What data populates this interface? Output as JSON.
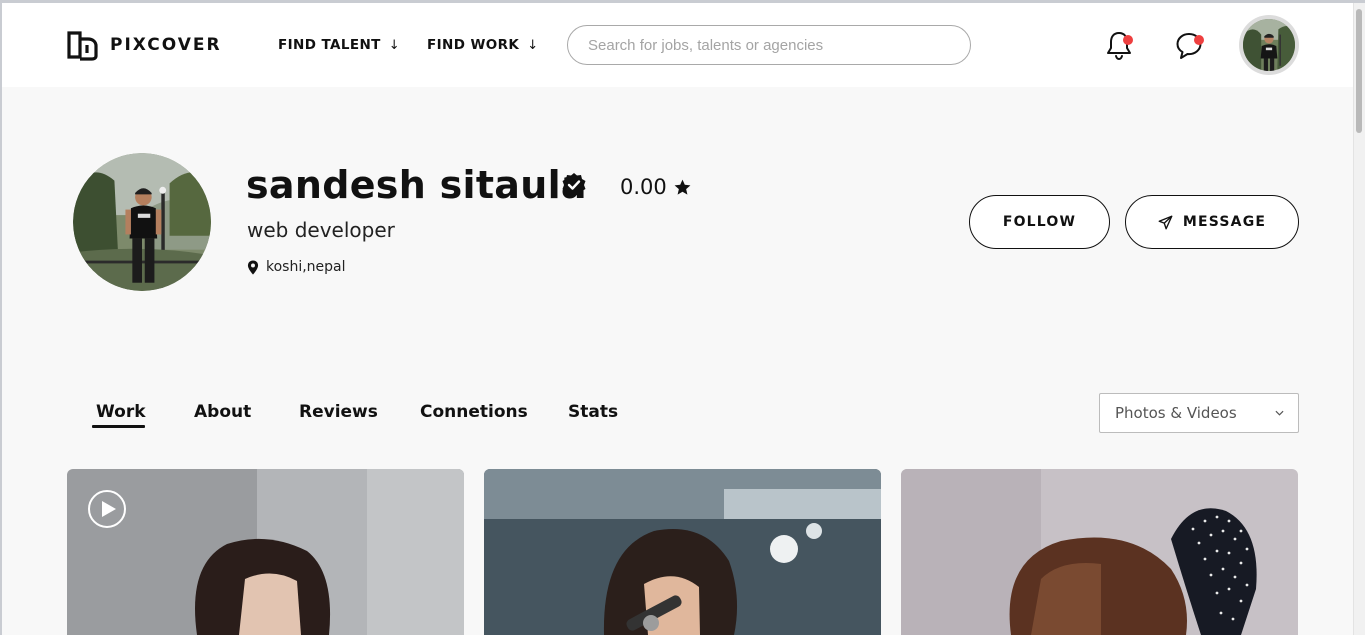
{
  "header": {
    "logo_text": "PIXCOVER",
    "nav": [
      {
        "label": "FIND TALENT",
        "arrow": "↓"
      },
      {
        "label": "FIND WORK",
        "arrow": "↓"
      }
    ],
    "search_placeholder": "Search for jobs, talents or agencies",
    "notification_badge_color": "#ee3f3f",
    "icons": [
      "bell-icon",
      "chat-bubble-icon"
    ]
  },
  "profile": {
    "name": "sandesh sitaula",
    "verified": true,
    "rating": "0.00",
    "rating_icon": "star-icon",
    "headline": "web developer",
    "location": "koshi,nepal",
    "follow_label": "FOLLOW",
    "message_label": "MESSAGE"
  },
  "tabs": [
    {
      "label": "Work",
      "active": true
    },
    {
      "label": "About",
      "active": false
    },
    {
      "label": "Reviews",
      "active": false
    },
    {
      "label": "Connetions",
      "active": false
    },
    {
      "label": "Stats",
      "active": false
    }
  ],
  "filter": {
    "selected": "Photos & Videos",
    "icon": "chevron-down-icon"
  },
  "work_items": [
    {
      "media": "video",
      "description": "woman with dark hair, grey background"
    },
    {
      "media": "photo",
      "description": "woman singing into microphone"
    },
    {
      "media": "photo",
      "description": "woman with polka-dot bow"
    }
  ]
}
